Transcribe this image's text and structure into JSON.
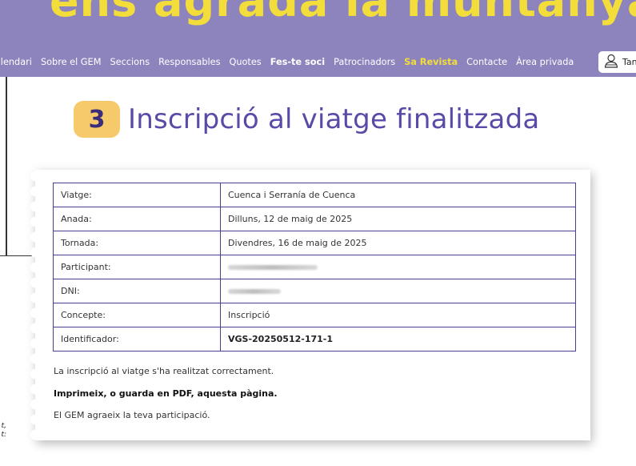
{
  "header": {
    "slogan": "ens agrada la muntanya"
  },
  "nav": {
    "items": [
      {
        "label": "Calendari",
        "style": "normal"
      },
      {
        "label": "Sobre el GEM",
        "style": "normal"
      },
      {
        "label": "Seccions",
        "style": "normal"
      },
      {
        "label": "Responsables",
        "style": "normal"
      },
      {
        "label": "Quotes",
        "style": "normal"
      },
      {
        "label": "Fes-te soci",
        "style": "bold"
      },
      {
        "label": "Patrocinadors",
        "style": "normal"
      },
      {
        "label": "Sa Revista",
        "style": "yellow"
      },
      {
        "label": "Contacte",
        "style": "normal"
      },
      {
        "label": "Àrea privada",
        "style": "normal"
      }
    ],
    "user_button_label": "Tancar",
    "user_icon": "user-icon"
  },
  "left_edge_text": [
    "t,",
    "t:"
  ],
  "page": {
    "step_number": "3",
    "title": "Inscripció al viatge finalitzada"
  },
  "summary": {
    "rows": [
      {
        "label": "Viatge:",
        "value": "Cuenca i Serranía de Cuenca"
      },
      {
        "label": "Anada:",
        "value": "Dilluns, 12 de maig de 2025"
      },
      {
        "label": "Tornada:",
        "value": "Divendres, 16 de maig de 2025"
      },
      {
        "label": "Participant:",
        "value": ""
      },
      {
        "label": "DNI:",
        "value": ""
      },
      {
        "label": "Concepte:",
        "value": "Inscripció"
      },
      {
        "label": "Identificador:",
        "value": "VGS-20250512-171-1"
      }
    ],
    "message_success": "La inscripció al viatge s'ha realitzat correctament.",
    "message_print": "Imprimeix, o guarda en PDF, aquesta pàgina.",
    "message_thanks": "El GEM agraeix la teva participació."
  },
  "colors": {
    "nav_bg": "#8d83bd",
    "accent_yellow": "#f2dd3b",
    "step_badge": "#f6c96b",
    "title_purple": "#5a4aa8",
    "table_border": "#4a3f8f"
  }
}
